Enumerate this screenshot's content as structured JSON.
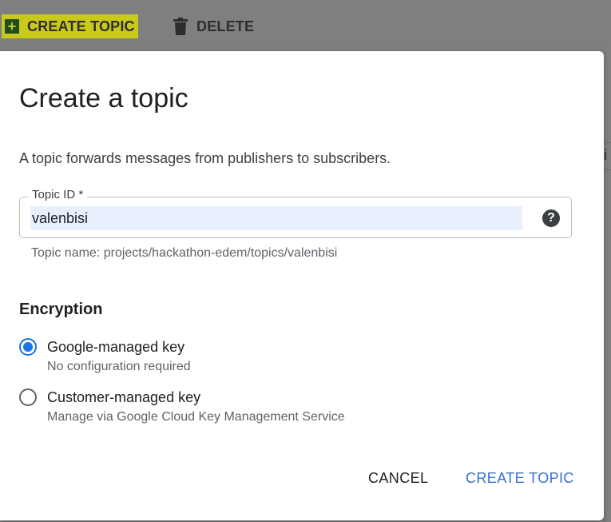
{
  "toolbar": {
    "create_label": "CREATE TOPIC",
    "delete_label": "DELETE",
    "create_icon": "plus-icon",
    "delete_icon": "trash-icon",
    "highlight_color": "#c9c91a"
  },
  "background": {
    "partial_char": "i"
  },
  "dialog": {
    "title": "Create a topic",
    "description": "A topic forwards messages from publishers to subscribers.",
    "topic_field": {
      "label": "Topic ID *",
      "value": "valenbisi",
      "hint": "Topic name: projects/hackathon-edem/topics/valenbisi",
      "help_icon": "help-icon",
      "help_glyph": "?"
    },
    "encryption": {
      "title": "Encryption",
      "options": [
        {
          "label": "Google-managed key",
          "sub": "No configuration required",
          "selected": true
        },
        {
          "label": "Customer-managed key",
          "sub": "Manage via Google Cloud Key Management Service",
          "selected": false
        }
      ]
    },
    "actions": {
      "cancel_label": "CANCEL",
      "create_label": "CREATE TOPIC",
      "accent_color": "#3b6fd1"
    }
  }
}
